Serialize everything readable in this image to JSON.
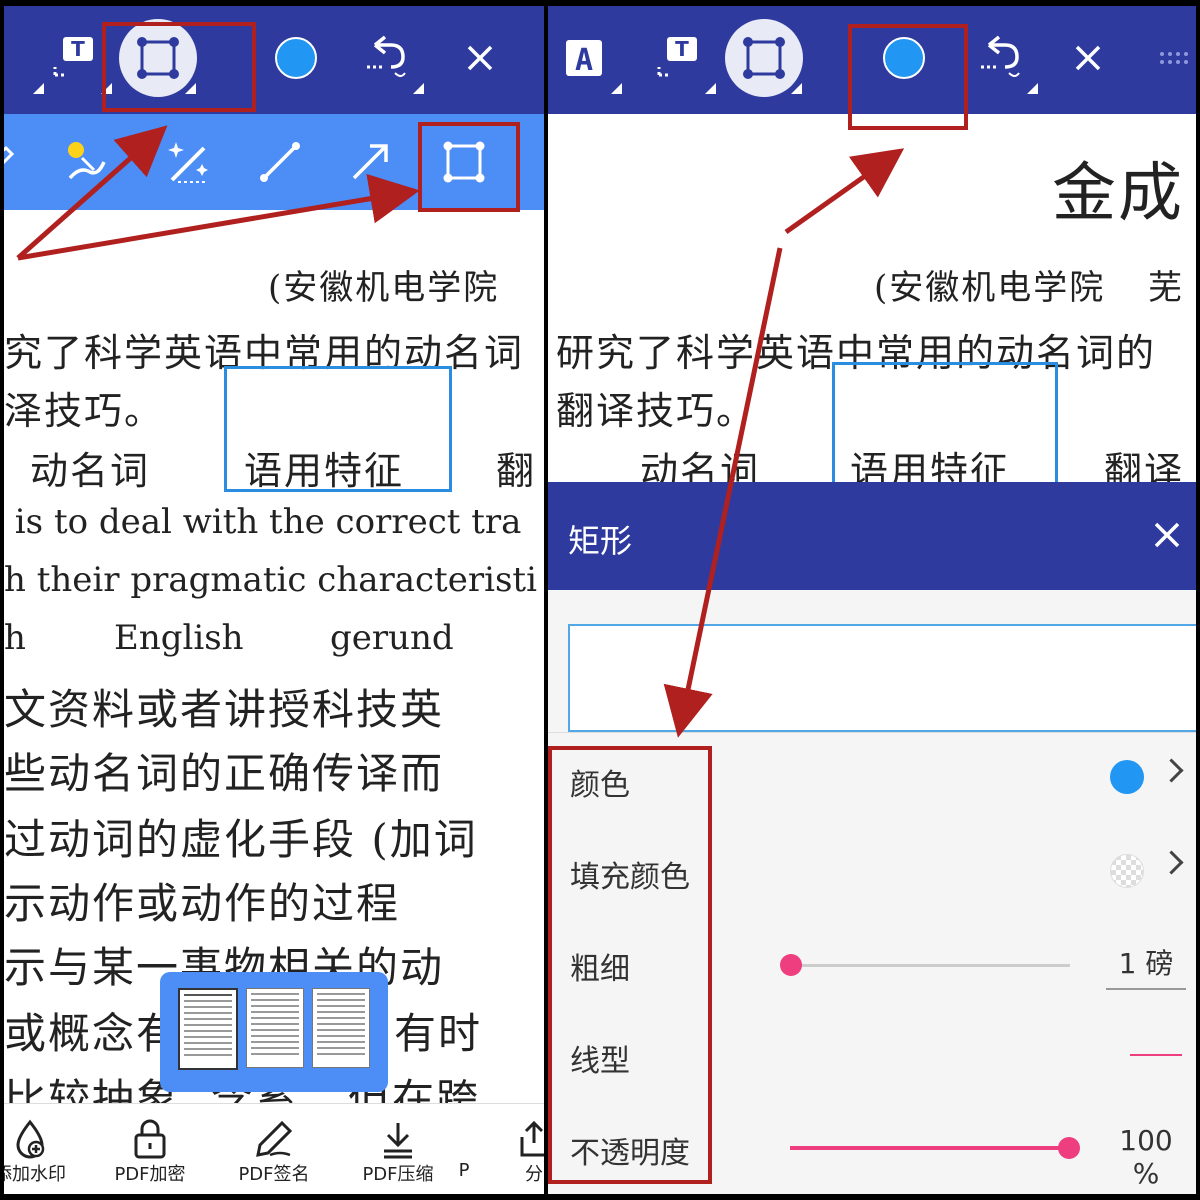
{
  "left_panel": {
    "doc": {
      "institution": "(安徽机电学院",
      "line1": "究了科学英语中常用的动名词",
      "line2": "泽技巧。",
      "kw1": "动名词",
      "kw2": "语用特征",
      "kw3": "翻",
      "en1": " is to deal with the correct tra",
      "en2": "h their pragmatic characteristi",
      "en3a": "h",
      "en3b": "English",
      "en3c": "gerund",
      "body": [
        "文资料或者讲授科技英",
        "些动名词的正确传译而",
        "过动词的虚化手段 (加词",
        "示动作或动作的过程",
        "示与某一事物相关的动",
        "或概念有",
        "有时",
        "比较抽象, 含蓄。",
        "但在跨"
      ]
    },
    "bottom_nav": [
      {
        "icon": "watermark-icon",
        "label": "添加水印"
      },
      {
        "icon": "lock-icon",
        "label": "PDF加密"
      },
      {
        "icon": "pen-icon",
        "label": "PDF签名"
      },
      {
        "icon": "compress-icon",
        "label": "PDF压缩"
      },
      {
        "icon": "more-icon",
        "label": "P"
      },
      {
        "icon": "share-icon",
        "label": "分"
      }
    ]
  },
  "right_panel": {
    "doc": {
      "title": "金成",
      "institution": "(安徽机电学院",
      "institution_tail": "芜",
      "line1": "研究了科学英语中常用的动名词的",
      "line2": "翻译技巧。",
      "kw1": "动名词",
      "kw2": "语用特征",
      "kw3": "翻译"
    },
    "sheet": {
      "title": "矩形",
      "rows": [
        {
          "label": "颜色"
        },
        {
          "label": "填充颜色"
        },
        {
          "label": "粗细",
          "value": "1 磅"
        },
        {
          "label": "线型"
        },
        {
          "label": "不透明度",
          "value": "100 %"
        }
      ]
    }
  },
  "colors": {
    "topbar": "#2e3a9e",
    "toolbar": "#4c8df6",
    "stroke_color": "#2196f3",
    "slider": "#ee3e7f",
    "annotation": "#b0201f"
  }
}
